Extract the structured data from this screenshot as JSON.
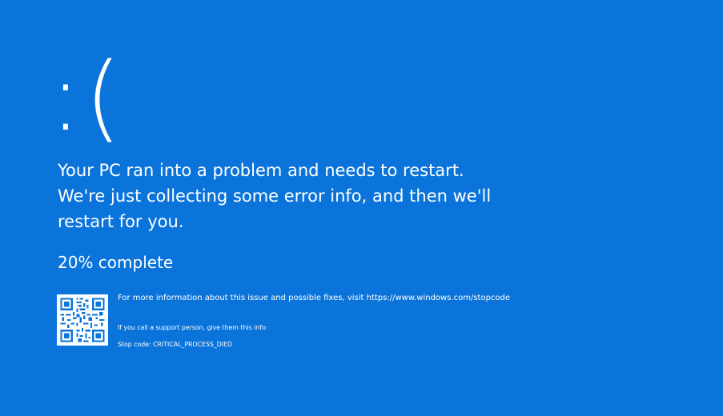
{
  "screen": {
    "background": "#0a74da",
    "text_color": "#ffffff",
    "emoticon": ":(",
    "message": "Your PC ran into a problem and needs to restart. We're just collecting some error info, and then we'll restart for you.",
    "progress": {
      "text": "20% complete",
      "value": 20
    },
    "qr_code": {
      "icon": "qr-code-icon"
    },
    "more_info": "For more information about this issue and possible fixes, visit https://www.windows.com/stopcode",
    "support_note": "If you call a support person, give them this info:",
    "stop_code": "Stop code: CRITICAL_PROCESS_DIED"
  }
}
